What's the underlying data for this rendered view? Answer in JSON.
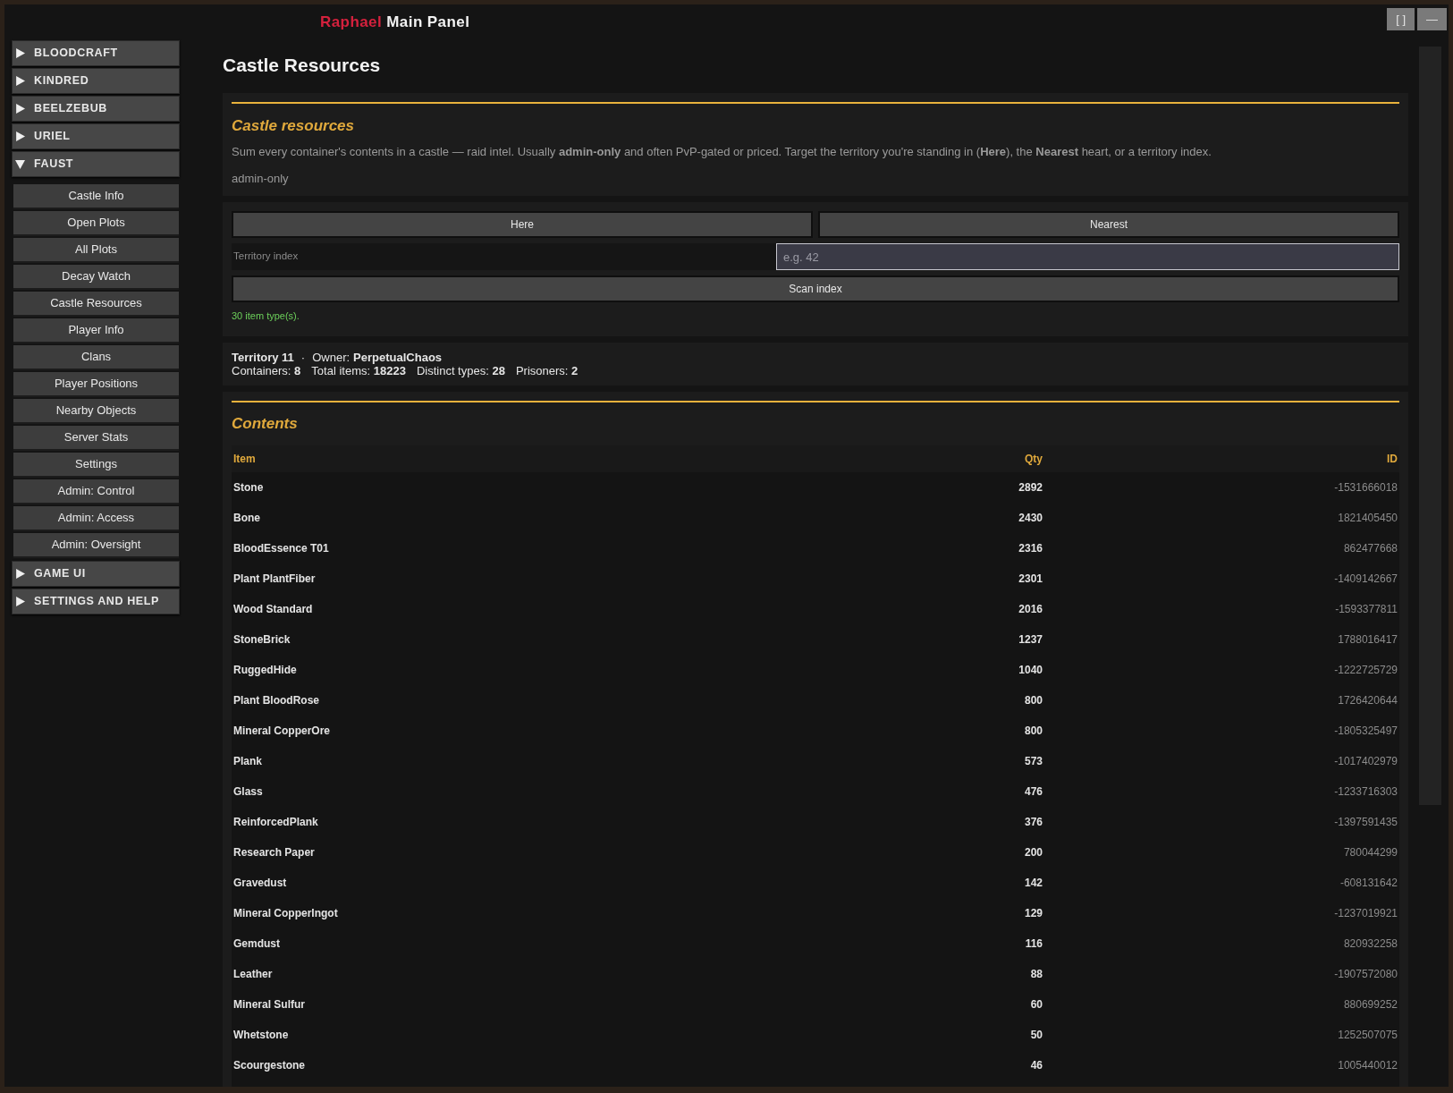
{
  "window": {
    "title_accent": "Raphael",
    "title": "Main Panel",
    "controls": [
      "[ ]",
      "—"
    ]
  },
  "sidebar": {
    "sections": [
      {
        "label": "BLOODCRAFT",
        "expanded": false
      },
      {
        "label": "KINDRED",
        "expanded": false
      },
      {
        "label": "BEELZEBUB",
        "expanded": false
      },
      {
        "label": "URIEL",
        "expanded": false
      },
      {
        "label": "FAUST",
        "expanded": true,
        "items": [
          "Castle Info",
          "Open Plots",
          "All Plots",
          "Decay Watch",
          "Castle Resources",
          "Player Info",
          "Clans",
          "Player Positions",
          "Nearby Objects",
          "Server Stats",
          "Settings",
          "Admin: Control",
          "Admin: Access",
          "Admin: Oversight"
        ]
      },
      {
        "label": "GAME UI",
        "expanded": false
      },
      {
        "label": "SETTINGS AND HELP",
        "expanded": false
      }
    ]
  },
  "page": {
    "title": "Castle Resources"
  },
  "info_card": {
    "heading": "Castle resources",
    "description": "Sum every container's contents in a castle — raid intel. Usually **admin-only** and often PvP-gated or priced. Target the territory you're standing in (**Here**), the **Nearest** heart, or a territory index.",
    "tag": "admin-only"
  },
  "controls": {
    "buttons": [
      "Here",
      "Nearest"
    ],
    "territory_label": "Territory index",
    "territory_field": {
      "placeholder": "e.g. 42"
    },
    "scan_button": "Scan index",
    "status": "30 item type(s)."
  },
  "summary": {
    "territory": "Territory 11",
    "separator": "·",
    "owner_label": "Owner:",
    "owner": "PerpetualChaos",
    "stats": [
      {
        "label": "Containers:",
        "value": "8"
      },
      {
        "label": "Total items:",
        "value": "18223"
      },
      {
        "label": "Distinct types:",
        "value": "28"
      },
      {
        "label": "Prisoners:",
        "value": "2"
      }
    ]
  },
  "contents": {
    "heading": "Contents",
    "columns": [
      "Item",
      "Qty",
      "ID"
    ],
    "rows": [
      [
        "Stone",
        "2892",
        "-1531666018"
      ],
      [
        "Bone",
        "2430",
        "1821405450"
      ],
      [
        "BloodEssence T01",
        "2316",
        "862477668"
      ],
      [
        "Plant PlantFiber",
        "2301",
        "-1409142667"
      ],
      [
        "Wood Standard",
        "2016",
        "-1593377811"
      ],
      [
        "StoneBrick",
        "1237",
        "1788016417"
      ],
      [
        "RuggedHide",
        "1040",
        "-1222725729"
      ],
      [
        "Plant BloodRose",
        "800",
        "1726420644"
      ],
      [
        "Mineral CopperOre",
        "800",
        "-1805325497"
      ],
      [
        "Plank",
        "573",
        "-1017402979"
      ],
      [
        "Glass",
        "476",
        "-1233716303"
      ],
      [
        "ReinforcedPlank",
        "376",
        "-1397591435"
      ],
      [
        "Research Paper",
        "200",
        "780044299"
      ],
      [
        "Gravedust",
        "142",
        "-608131642"
      ],
      [
        "Mineral CopperIngot",
        "129",
        "-1237019921"
      ],
      [
        "Gemdust",
        "116",
        "820932258"
      ],
      [
        "Leather",
        "88",
        "-1907572080"
      ],
      [
        "Mineral Sulfur",
        "60",
        "880699252"
      ],
      [
        "Whetstone",
        "50",
        "1252507075"
      ],
      [
        "Scourgestone",
        "46",
        "1005440012"
      ]
    ]
  }
}
